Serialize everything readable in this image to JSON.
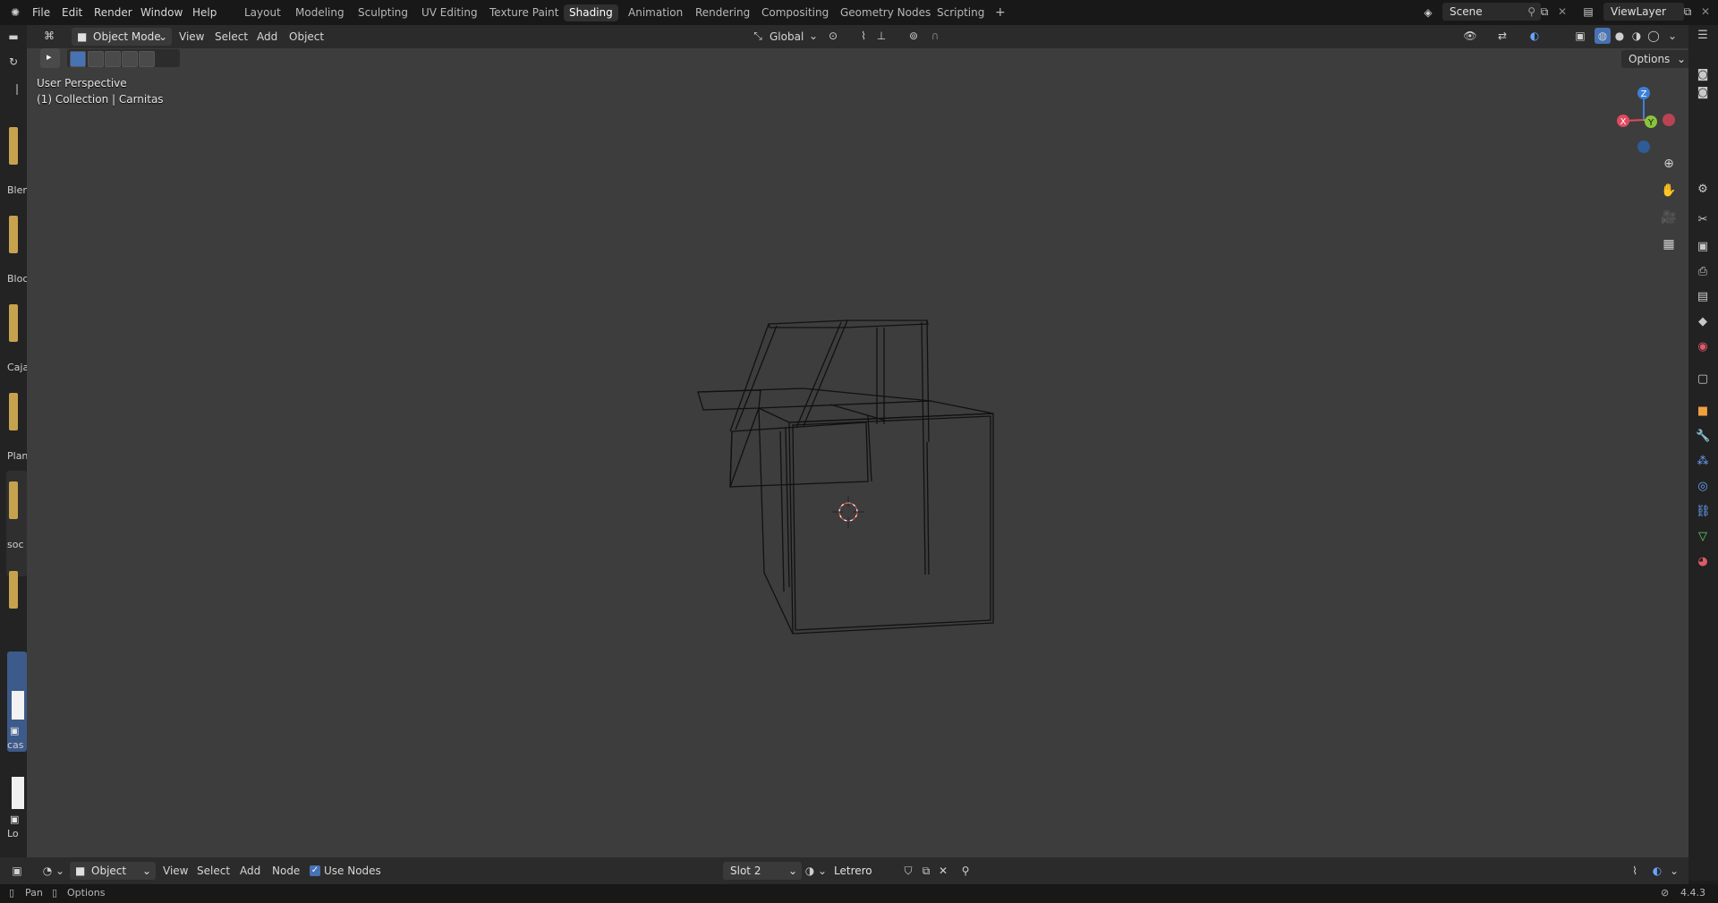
{
  "menu": {
    "file": "File",
    "edit": "Edit",
    "render": "Render",
    "window": "Window",
    "help": "Help"
  },
  "workspaces": [
    "Layout",
    "Modeling",
    "Sculpting",
    "UV Editing",
    "Texture Paint",
    "Shading",
    "Animation",
    "Rendering",
    "Compositing",
    "Geometry Nodes",
    "Scripting"
  ],
  "active_workspace": "Shading",
  "add_tab": "+",
  "scene_name": "Scene",
  "view_layer_name": "ViewLayer",
  "viewport_header": {
    "mode": "Object Mode",
    "view": "View",
    "select": "Select",
    "add": "Add",
    "object": "Object",
    "orientation": "Global",
    "options": "Options"
  },
  "overlay": {
    "perspective": "User Perspective",
    "collection": "(1) Collection | Carnitas"
  },
  "gizmo": {
    "x": "X",
    "y": "Y",
    "z": "Z"
  },
  "left_assets": [
    "Blen",
    "Bloc",
    "Caja",
    "Plan",
    "soc",
    "cas",
    "Lo"
  ],
  "bottom_header": {
    "object_dropdown": "Object",
    "view": "View",
    "select": "Select",
    "add": "Add",
    "node": "Node",
    "use_nodes": "Use Nodes",
    "slot": "Slot 2",
    "material": "Letrero"
  },
  "status": {
    "pan": "Pan",
    "options": "Options",
    "version": "4.4.3"
  },
  "colors": {
    "accent": "#4772b3",
    "x_axis": "#e04a5f",
    "y_axis": "#8ac43a",
    "z_axis": "#3d7fd9",
    "asset_thumb": "#c7a24e"
  }
}
